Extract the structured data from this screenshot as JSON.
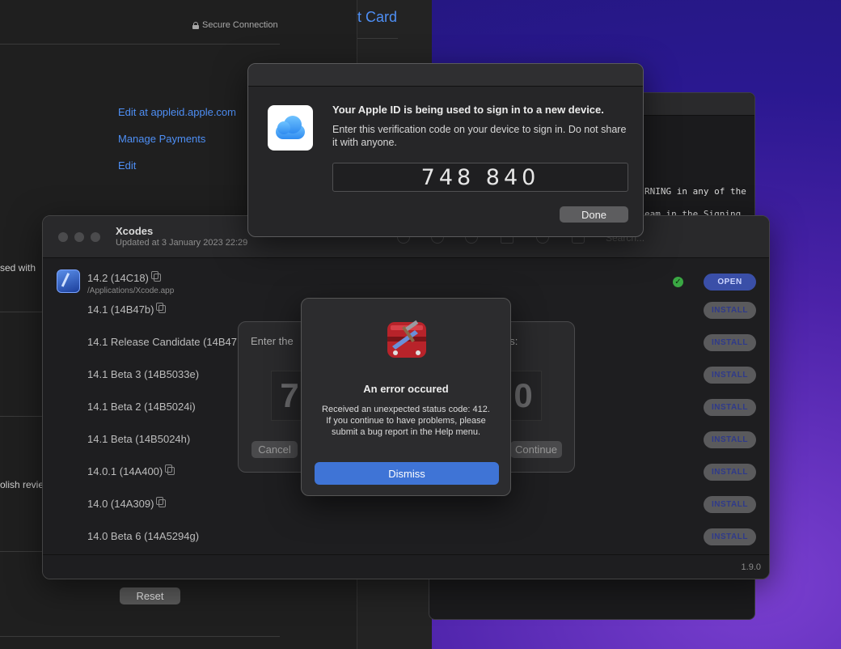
{
  "bg_window": {
    "secure_label": "Secure Connection",
    "links": [
      "Edit at appleid.apple.com",
      "Manage Payments",
      "Edit"
    ],
    "fragment_1": "sed with",
    "fragment_2": "olish revie",
    "reset_label": "Reset"
  },
  "mid_window": {
    "card_title": "t Card"
  },
  "terminal": {
    "line_1": "RNING in any of the",
    "line_2": "eam in the Signing"
  },
  "xcodes": {
    "title": "Xcodes",
    "subtitle": "Updated at 3 January 2023 22:29",
    "search_placeholder": "Search...",
    "installed": {
      "version": "14.2 (14C18)",
      "path": "/Applications/Xcode.app",
      "action": "OPEN"
    },
    "versions": [
      {
        "label": "14.1 (14B47b)",
        "copy": true,
        "action": "INSTALL"
      },
      {
        "label": "14.1 Release Candidate (14B47",
        "copy": false,
        "action": "INSTALL"
      },
      {
        "label": "14.1 Beta 3 (14B5033e)",
        "copy": false,
        "action": "INSTALL"
      },
      {
        "label": "14.1 Beta 2 (14B5024i)",
        "copy": false,
        "action": "INSTALL"
      },
      {
        "label": "14.1 Beta (14B5024h)",
        "copy": false,
        "action": "INSTALL"
      },
      {
        "label": "14.0.1 (14A400)",
        "copy": true,
        "action": "INSTALL"
      },
      {
        "label": "14.0 (14A309)",
        "copy": true,
        "action": "INSTALL"
      },
      {
        "label": "14.0 Beta 6 (14A5294g)",
        "copy": false,
        "action": "INSTALL"
      }
    ],
    "app_version": "1.9.0"
  },
  "code_sheet": {
    "prompt": "Enter the",
    "prompt_tail": "es:",
    "digit_left": "7",
    "digit_right": "0",
    "cancel_label": "Cancel",
    "continue_label": "Continue"
  },
  "appleid_dialog": {
    "headline": "Your Apple ID is being used to sign in to a new device.",
    "body": "Enter this verification code on your device to sign in. Do not share it with anyone.",
    "code": "748 840",
    "done_label": "Done"
  },
  "error_alert": {
    "title": "An error occured",
    "message": "Received an unexpected status code: 412. If you continue to have problems, please submit a bug report in the Help menu.",
    "dismiss_label": "Dismiss"
  }
}
